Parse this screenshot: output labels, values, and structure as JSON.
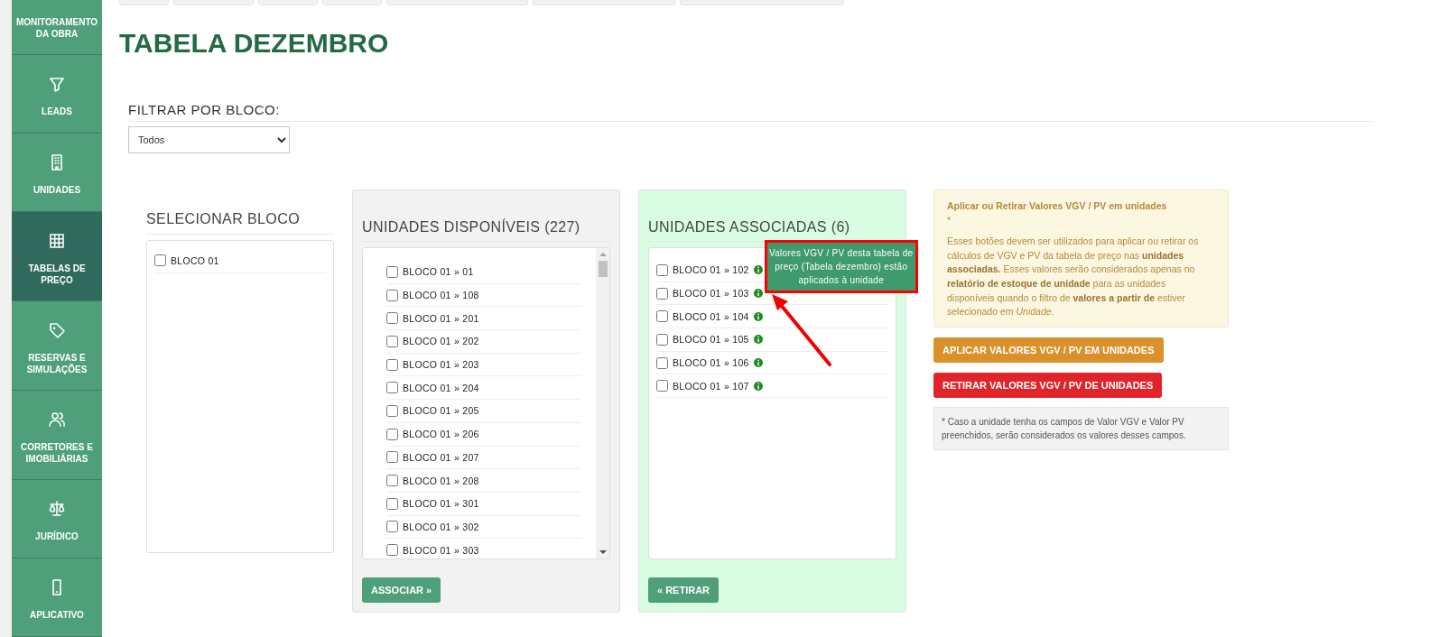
{
  "sidebar": {
    "items": [
      {
        "label": "MONITORAMENTO DA OBRA",
        "selected": false
      },
      {
        "label": "LEADS",
        "selected": false
      },
      {
        "label": "UNIDADES",
        "selected": false
      },
      {
        "label": "TABELAS DE PREÇO",
        "selected": true
      },
      {
        "label": "RESERVAS E SIMULAÇÕES",
        "selected": false
      },
      {
        "label": "CORRETORES E IMOBILIÁRIAS",
        "selected": false
      },
      {
        "label": "JURÍDICO",
        "selected": false
      },
      {
        "label": "APLICATIVO",
        "selected": false
      }
    ]
  },
  "page": {
    "title": "TABELA DEZEMBRO"
  },
  "filter": {
    "label": "FILTRAR POR BLOCO:",
    "value": "Todos"
  },
  "block_select": {
    "title": "SELECIONAR BLOCO",
    "items": [
      {
        "label": "BLOCO 01",
        "checked": false
      }
    ]
  },
  "available": {
    "title": "UNIDADES DISPONÍVEIS (227)",
    "button": "ASSOCIAR »",
    "items": [
      {
        "label": "BLOCO 01 » 01",
        "checked": false
      },
      {
        "label": "BLOCO 01 » 108",
        "checked": false
      },
      {
        "label": "BLOCO 01 » 201",
        "checked": false
      },
      {
        "label": "BLOCO 01 » 202",
        "checked": false
      },
      {
        "label": "BLOCO 01 » 203",
        "checked": false
      },
      {
        "label": "BLOCO 01 » 204",
        "checked": false
      },
      {
        "label": "BLOCO 01 » 205",
        "checked": false
      },
      {
        "label": "BLOCO 01 » 206",
        "checked": false
      },
      {
        "label": "BLOCO 01 » 207",
        "checked": false
      },
      {
        "label": "BLOCO 01 » 208",
        "checked": false
      },
      {
        "label": "BLOCO 01 » 301",
        "checked": false
      },
      {
        "label": "BLOCO 01 » 302",
        "checked": false
      },
      {
        "label": "BLOCO 01 » 303",
        "checked": false
      }
    ]
  },
  "associated": {
    "title": "UNIDADES ASSOCIADAS (6)",
    "button": "« RETIRAR",
    "items": [
      {
        "label": "BLOCO 01 » 102",
        "checked": false,
        "tooltip": "Valores VGV / PV desta tabela de preço (Tabela dezembro) estão aplicados à unidade"
      },
      {
        "label": "BLOCO 01 » 103",
        "checked": false
      },
      {
        "label": "BLOCO 01 » 104",
        "checked": false
      },
      {
        "label": "BLOCO 01 » 105",
        "checked": false
      },
      {
        "label": "BLOCO 01 » 106",
        "checked": false
      },
      {
        "label": "BLOCO 01 » 107",
        "checked": false
      }
    ]
  },
  "values_panel": {
    "info_title": "Aplicar ou Retirar Valores VGV / PV em unidades",
    "info_mark": "*",
    "info_text": "Esses botões devem ser utilizados para aplicar ou retirar os cálculos de VGV e PV da tabela de preço nas **unidades associadas.** Esses valores serão considerados apenas no **relatório de estoque de unidade** para as unidades disponíveis quando o filtro de **valores a partir de** estiver selecionado em *Unidade*.",
    "apply_button": "APLICAR VALORES VGV / PV EM UNIDADES",
    "remove_button": "RETIRAR VALORES VGV / PV DE UNIDADES",
    "note": "* Caso a unidade tenha os campos de Valor VGV e Valor PV preenchidos, serão considerados os valores desses campos."
  }
}
